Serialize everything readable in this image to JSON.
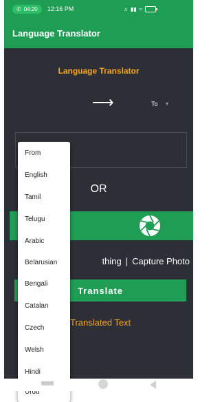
{
  "status_bar": {
    "call_time": "04:20",
    "clock": "12:16 PM",
    "battery_level": "80"
  },
  "app_bar": {
    "title": "Language Translator"
  },
  "main": {
    "heading": "Language Translator",
    "to_label": "To",
    "or_label": "OR",
    "caption_left": "thing",
    "caption_sep": "|",
    "caption_right": "Capture Photo",
    "translate_label": "Translate",
    "translated_text": "Translated Text"
  },
  "dropdown": {
    "items": [
      "From",
      "English",
      "Tamil",
      "Telugu",
      "Arabic",
      "Belarusian",
      "Bengali",
      "Catalan",
      "Czech",
      "Welsh",
      "Hindi",
      "Urdu"
    ]
  },
  "colors": {
    "primary": "#1f9d55",
    "accent": "#f6a623",
    "background": "#2c2f36"
  }
}
